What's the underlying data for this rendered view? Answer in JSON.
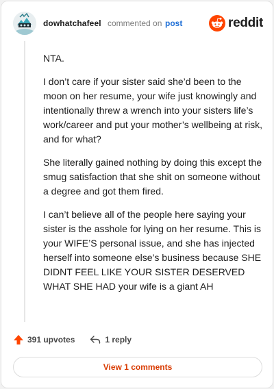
{
  "comment": {
    "username": "dowhatchafeel",
    "action_text": "commented on",
    "post_link_text": "post",
    "paragraphs": [
      "NTA.",
      "I don’t care if your sister said she’d been to the moon on her resume, your wife just knowingly and intentionally threw a wrench into your sisters life’s work/career and put your mother’s wellbeing at risk, and for what?",
      "She literally gained nothing by doing this except the smug satisfaction that she shit on someone without a degree and got them fired.",
      "I can’t believe all of the people here saying your sister is the asshole for lying on her resume. This is your WIFE’S personal issue, and she has injected herself into someone else’s business because SHE DIDNT FEEL LIKE YOUR SISTER DESERVED WHAT SHE HAD your wife is a giant AH"
    ]
  },
  "brand": {
    "name": "reddit",
    "color": "#ff4500"
  },
  "actions": {
    "upvotes_label": "391 upvotes",
    "replies_label": "1 reply",
    "upvote_icon": "upvote-arrow-icon",
    "reply_icon": "reply-arrow-icon"
  },
  "view_comments_label": "View 1 comments",
  "colors": {
    "accent": "#d93a00",
    "upvote": "#ff4500",
    "link": "#1f6fd6"
  }
}
